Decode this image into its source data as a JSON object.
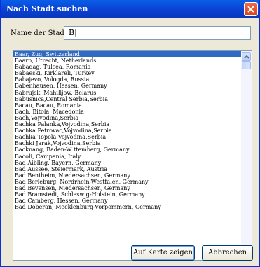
{
  "window": {
    "title": "Nach Stadt suchen"
  },
  "form": {
    "label": "Name der Stadt",
    "value": "B|"
  },
  "list": {
    "items": [
      "Baar, Zug, Switzerland",
      "Baarn, Utrecht, Netherlands",
      "Babadag, Tulcea, Romania",
      "Babaeski, Kirklareli, Turkey",
      "Babajevo, Vologda, Russia",
      "Babenhausen, Hessen, Germany",
      "Babrujsk, Mahilijow, Belarus",
      "Babusnica,Central Serbia,Serbia",
      "Bacau, Bacau, Romania",
      "Bach, Bitola, Macedonia",
      "Bach,Vojvodina,Serbia",
      "Bachka Palanka,Vojvodina,Serbia",
      "Bachka Petrovac,Vojvodina,Serbia",
      "Bachka Topola,Vojvodina,Serbia",
      "Bachki Jarak,Vojvodina,Serbia",
      "Backnang, Baden-W     ttemberg, Germany",
      "Bacoli, Campania, Italy",
      "Bad Aibling, Bayern, Germany",
      "Bad Aussee, Steiermark, Austria",
      "Bad Bentheim, Niedersachsen, Germany",
      "Bad Berleburg, Nordrhein-Westfalen, Germany",
      "Bad Bevensen, Niedersachsen, Germany",
      "Bad Bramstedt, Schleswig-Holstein, Germany",
      "Bad Camberg, Hessen, Germany",
      "Bad Doberan, Mecklenburg-Vorpommern, Germany"
    ],
    "selected_index": 0
  },
  "buttons": {
    "map": "Auf Karte zeigen",
    "cancel": "Abbrechen"
  },
  "icons": {
    "close": "close-icon",
    "scroll_up": "chevron-up-icon",
    "scroll_down": "chevron-down-icon"
  }
}
